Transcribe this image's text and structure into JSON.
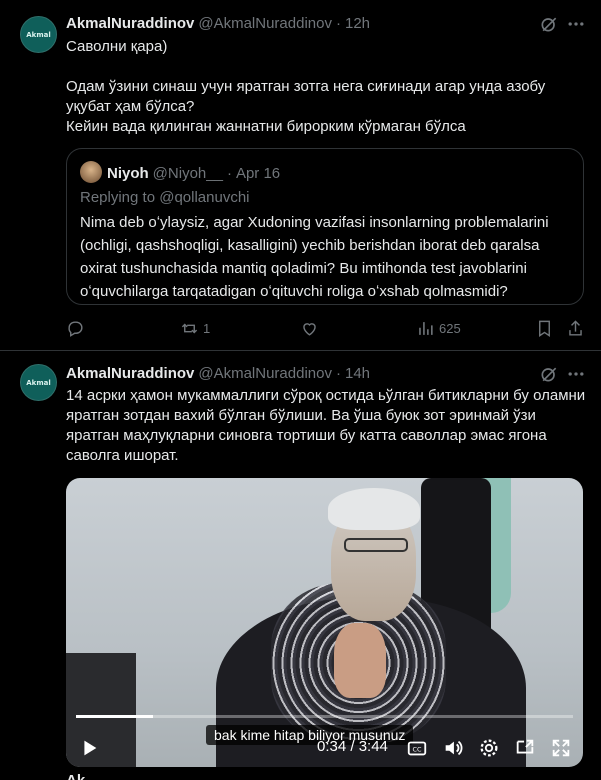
{
  "tweets": [
    {
      "author": {
        "name": "AkmalNuraddinov",
        "handle": "@AkmalNuraddinov",
        "time": "12h",
        "avatar_text": "Akmal"
      },
      "text": "Саволни қара)\n\nОдам ўзини синаш учун яратган зотга нега сиғинади агар унда азобу уқубат ҳам бўлса?\nКейин вада қилинган жаннатни бирорким кўрмаган бўлса",
      "quote": {
        "author": {
          "name": "Niyoh",
          "handle": "@Niyoh__",
          "time": "Apr 16"
        },
        "replying_label": "Replying to",
        "replying_to": "@qollanuvchi",
        "text": "Nima deb oʻylaysiz, agar Xudoning vazifasi insonlarning problemalarini (ochligi, qashshoqligi, kasalligini)  yechib berishdan iborat deb qaralsa oxirat tushunchasida mantiq qoladimi? Bu imtihonda test javoblarini oʻquvchilarga tarqatadigan oʻqituvchi roliga oʻxshab qolmasmidi?"
      },
      "actions": {
        "replies": "",
        "reposts": "1",
        "likes": "",
        "views": "625"
      }
    },
    {
      "author": {
        "name": "AkmalNuraddinov",
        "handle": "@AkmalNuraddinov",
        "time": "14h",
        "avatar_text": "Akmal"
      },
      "text": "14 асрки ҳамон мукаммаллиги сўроқ остида ьўлган битикларни бу оламни яратган зотдан вахий бўлган бўлиши. Ва ўша буюк зот эринмай ўзи яратган маҳлуқларни синовга тортиши бу катта саволлар эмас ягона саволга ишорат.",
      "video": {
        "subtitle": "bak kime hitap biliyor musunuz",
        "time": "0:34 / 3:44",
        "progress": 0.155
      }
    }
  ],
  "bottom_peek": "Ak"
}
